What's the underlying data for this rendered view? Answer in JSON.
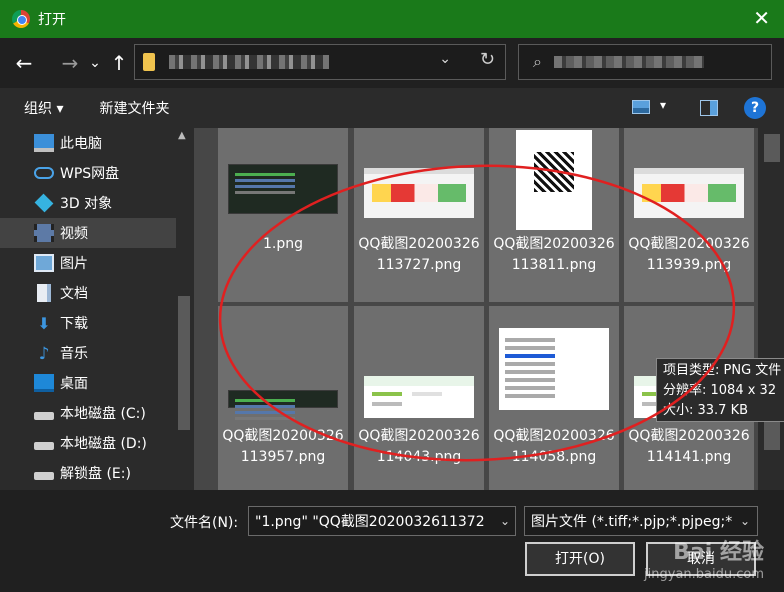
{
  "window": {
    "title": "打开",
    "close_glyph": "✕"
  },
  "nav": {
    "back_glyph": "←",
    "forward_glyph": "→",
    "recent_glyph": "⌄",
    "up_glyph": "↑",
    "address_chevron": "⌄",
    "refresh_glyph": "↻",
    "search_glyph": "⌕"
  },
  "toolbar": {
    "organize_label": "组织 ▾",
    "new_folder_label": "新建文件夹",
    "view_chevron": "▾",
    "help_glyph": "?"
  },
  "sidebar": {
    "scroll_up": "▲",
    "items": [
      {
        "label": "此电脑"
      },
      {
        "label": "WPS网盘"
      },
      {
        "label": "3D 对象"
      },
      {
        "label": "视频"
      },
      {
        "label": "图片"
      },
      {
        "label": "文档"
      },
      {
        "label": "下载"
      },
      {
        "label": "音乐"
      },
      {
        "label": "桌面"
      },
      {
        "label": "本地磁盘 (C:)"
      },
      {
        "label": "本地磁盘 (D:)"
      },
      {
        "label": "解锁盘 (E:)"
      }
    ],
    "icons": {
      "download": "⬇",
      "music": "♪"
    }
  },
  "files": [
    {
      "name": "1.png"
    },
    {
      "name": "QQ截图20200326113727.png"
    },
    {
      "name": "QQ截图20200326113811.png"
    },
    {
      "name": "QQ截图20200326113939.png"
    },
    {
      "name": "QQ截图20200326113957.png"
    },
    {
      "name": "QQ截图20200326114043.png"
    },
    {
      "name": "QQ截图20200326114058.png"
    },
    {
      "name": "QQ截图20200326114141.png"
    }
  ],
  "tooltip": {
    "type_line": "项目类型: PNG 文件",
    "resolution_line": "分辨率: 1084 x 32",
    "size_line": "大小: 33.7 KB"
  },
  "footer": {
    "filename_label": "文件名(N):",
    "filename_value": "\"1.png\" \"QQ截图2020032611372",
    "filename_chevron": "⌄",
    "filetype_value": "图片文件 (*.tiff;*.pjp;*.pjpeg;*",
    "filetype_chevron": "⌄",
    "open_label": "打开(O)",
    "cancel_label": "取消"
  },
  "watermark": {
    "brand": "Bai 经验",
    "url": "jingyan.baidu.com"
  },
  "colors": {
    "titlebar": "#1a7a1a",
    "annotation": "#e02020",
    "content_bg": "#474747"
  }
}
